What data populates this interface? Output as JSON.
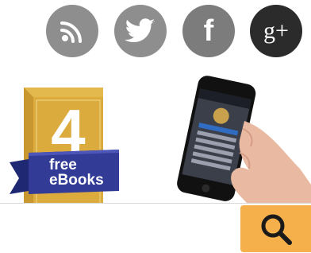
{
  "social": {
    "items": [
      {
        "name": "rss",
        "icon": "rss-icon",
        "color": "#8e8e8e"
      },
      {
        "name": "twitter",
        "icon": "twitter-bird-icon",
        "color": "#8e8e8e"
      },
      {
        "name": "facebook",
        "icon": "facebook-f-icon",
        "color": "#7c7c7c"
      },
      {
        "name": "google-plus",
        "icon": "google-plus-icon",
        "color": "#2b2b2b"
      }
    ],
    "facebook_glyph": "f",
    "gplus_glyph": "g+"
  },
  "book_promo": {
    "number": "4",
    "line1": "free",
    "line2": "eBooks",
    "book_color": "#d9a93a",
    "ribbon_color": "#2f3a8f"
  },
  "app_promo": {
    "phone_color": "#111111"
  },
  "search": {
    "placeholder": "",
    "button_color": "#f6b04b",
    "button_icon": "search-icon"
  }
}
